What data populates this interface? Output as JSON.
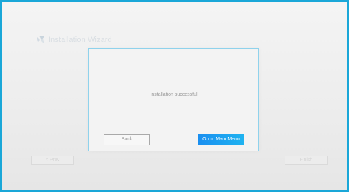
{
  "background": {
    "wizard_title": "Installation Wizard",
    "prev_button_label": "< Prev",
    "finish_button_label": "Finish"
  },
  "dialog": {
    "message": "Installation successful",
    "back_label": "Back",
    "main_menu_label": "Go to Main Menu"
  },
  "colors": {
    "frame": "#1aa7d8",
    "dialog_border": "#8fd2ec",
    "primary_button": "#1a8ff0",
    "background": "#eeeeee"
  },
  "icons": {
    "logo": "wizard-logo-icon"
  }
}
